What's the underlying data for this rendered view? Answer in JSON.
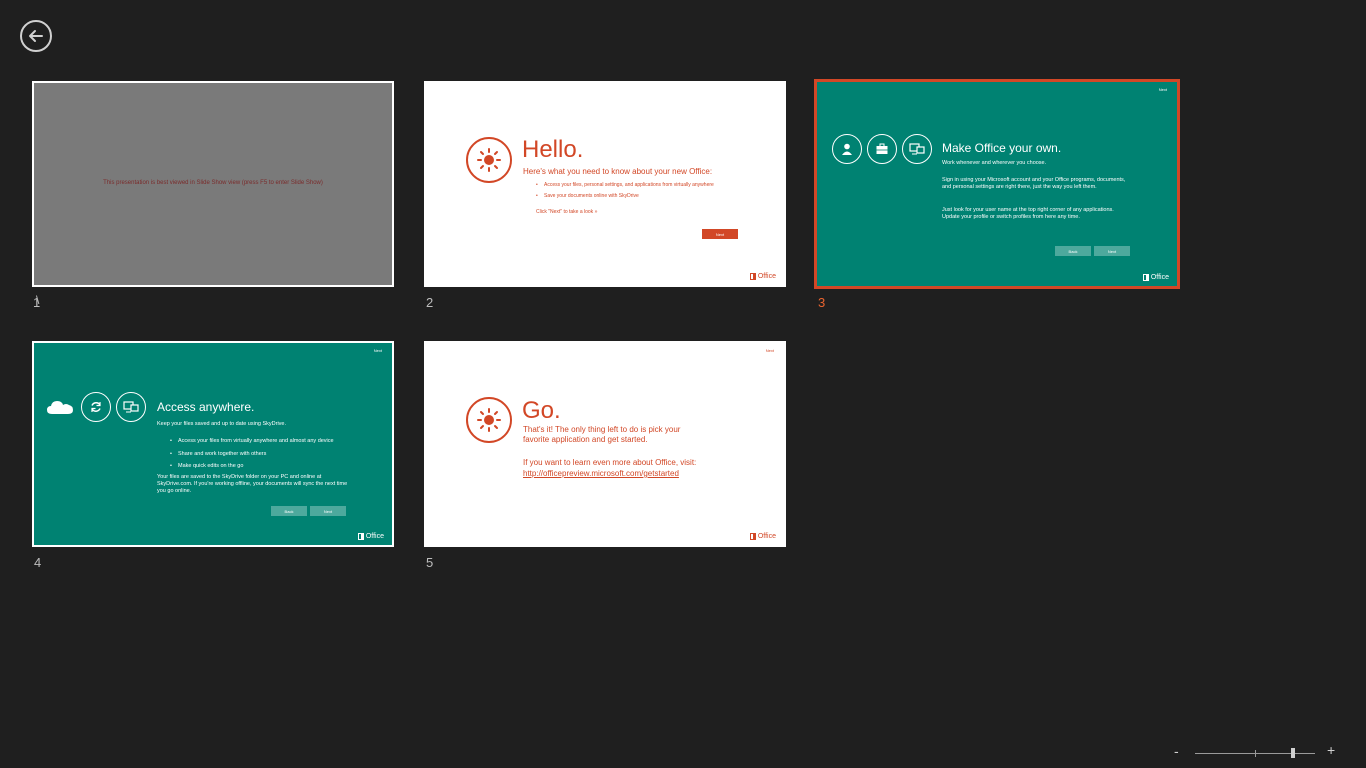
{
  "nav": {
    "back_label": "Back"
  },
  "slides": [
    {
      "number": "1",
      "text": "This presentation is best viewed in Slide Show view (press F5 to enter Slide Show)"
    },
    {
      "number": "2",
      "title": "Hello.",
      "subtitle": "Here's what you need to know about your new Office:",
      "bullets": [
        "Access your files, personal settings, and applications from virtually anywhere",
        "Save your documents online with SkyDrive"
      ],
      "hint": "Click \"Next\" to take a look »",
      "next_label": "Next",
      "logo_text": "Office"
    },
    {
      "number": "3",
      "top_text": "Next",
      "title": "Make Office your own.",
      "line1": "Work whenever and wherever you choose.",
      "para1": "Sign in using your Microsoft account and your Office programs, documents, and personal settings are right there, just the way you left them.",
      "para2": "Just look for your user name at the top right corner of any applications.  Update your profile or switch profiles from here any time.",
      "back_label": "Back",
      "next_label": "Next",
      "logo_text": "Office"
    },
    {
      "number": "4",
      "top_text": "Next",
      "title": "Access anywhere.",
      "line1": "Keep your files saved and up to date using SkyDrive.",
      "bullets": [
        "Access your files from virtually anywhere and almost any device",
        "Share and work together with others",
        "Make quick edits on the go"
      ],
      "para1": "Your files are saved to the SkyDrive folder on your PC and online at SkyDrive.com.  If you're working offline, your documents will sync the next time you go online.",
      "back_label": "Back",
      "next_label": "Next",
      "logo_text": "Office"
    },
    {
      "number": "5",
      "top_text": "Next",
      "title": "Go.",
      "line1": "That's it!  The only thing left to do is pick your favorite application and get started.",
      "line2": "If you want to learn even more about Office, visit:",
      "link": "http://officepreview.microsoft.com/getstarted",
      "logo_text": "Office"
    }
  ],
  "zoom": {
    "minus": "-",
    "plus": "+",
    "level_fraction": 0.82
  },
  "colors": {
    "accent": "#d24726",
    "teal": "#008272",
    "background": "#1f1f1f"
  }
}
